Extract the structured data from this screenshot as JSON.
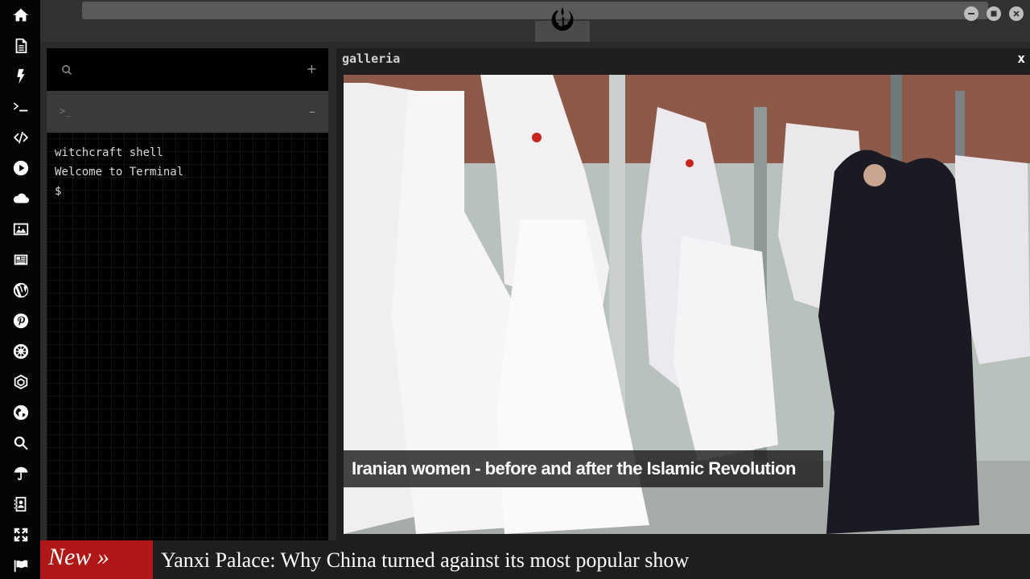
{
  "sidebar": {
    "items": [
      {
        "icon": "home-icon"
      },
      {
        "icon": "document-icon"
      },
      {
        "icon": "lightning-icon"
      },
      {
        "icon": "terminal-icon"
      },
      {
        "icon": "code-icon"
      },
      {
        "icon": "play-icon"
      },
      {
        "icon": "cloud-icon"
      },
      {
        "icon": "image-icon"
      },
      {
        "icon": "newspaper-icon"
      },
      {
        "icon": "wordpress-icon"
      },
      {
        "icon": "pinterest-icon"
      },
      {
        "icon": "galactic-empire-icon"
      },
      {
        "icon": "jedi-order-icon"
      },
      {
        "icon": "globe-icon"
      },
      {
        "icon": "search-icon"
      },
      {
        "icon": "umbrella-icon"
      },
      {
        "icon": "address-book-icon"
      },
      {
        "icon": "expand-icon"
      },
      {
        "icon": "flag-icon"
      }
    ]
  },
  "topbar": {
    "logo_icon": "rebel-alliance-icon",
    "window_buttons": [
      "minimize-icon",
      "maximize-icon",
      "close-icon"
    ]
  },
  "terminal": {
    "search_icon": "search-icon",
    "add_label": "+",
    "tab_prompt": ">_",
    "collapse_label": "–",
    "lines": [
      "witchcraft shell",
      "Welcome to Terminal",
      "$"
    ]
  },
  "gallery": {
    "title": "galleria",
    "close_label": "x",
    "caption": "Iranian women - before and after the Islamic Revolution"
  },
  "ticker": {
    "badge": "New »",
    "headline": "Yanxi Palace: Why China turned against its most popular show"
  },
  "colors": {
    "sidebar_bg": "#050505",
    "topbar_bg": "#323232",
    "ticker_badge": "#b01818"
  }
}
